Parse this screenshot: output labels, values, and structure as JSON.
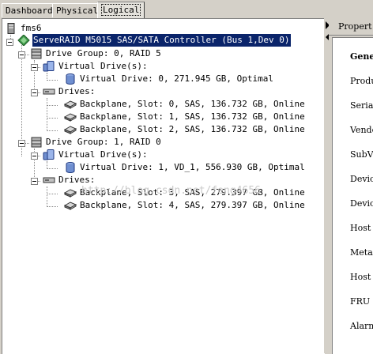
{
  "tabs": [
    {
      "label": "Dashboard"
    },
    {
      "label": "Physical"
    },
    {
      "label": "Logical"
    }
  ],
  "tree": {
    "root": "fms6",
    "controller": "ServeRAID M5015 SAS/SATA Controller (Bus 1,Dev 0)",
    "group0": {
      "label": "Drive Group: 0, RAID  5",
      "virtual_header": "Virtual Drive(s):",
      "virtual_drive": "Virtual Drive: 0, 271.945 GB, Optimal",
      "drives_header": "Drives:",
      "drives": [
        "Backplane, Slot: 0, SAS, 136.732 GB, Online",
        "Backplane, Slot: 1, SAS, 136.732 GB, Online",
        "Backplane, Slot: 2, SAS, 136.732 GB, Online"
      ]
    },
    "group1": {
      "label": "Drive Group: 1, RAID  0",
      "virtual_header": "Virtual Drive(s):",
      "virtual_drive": "Virtual Drive: 1, VD_1, 556.930 GB, Optimal",
      "drives_header": "Drives:",
      "drives": [
        "Backplane, Slot: 3, SAS, 279.397 GB, Online",
        "Backplane, Slot: 4, SAS, 279.397 GB, Online"
      ]
    }
  },
  "watermark": "http://blog.csdn.net/feng4656",
  "properties": {
    "header": "Propert",
    "rows": [
      "Gene",
      "Produ",
      "Seria",
      "Vendo",
      "SubVe",
      "Devic",
      "Devic",
      "Host",
      "Metad",
      "Host",
      "FRU",
      "Alarm"
    ]
  }
}
